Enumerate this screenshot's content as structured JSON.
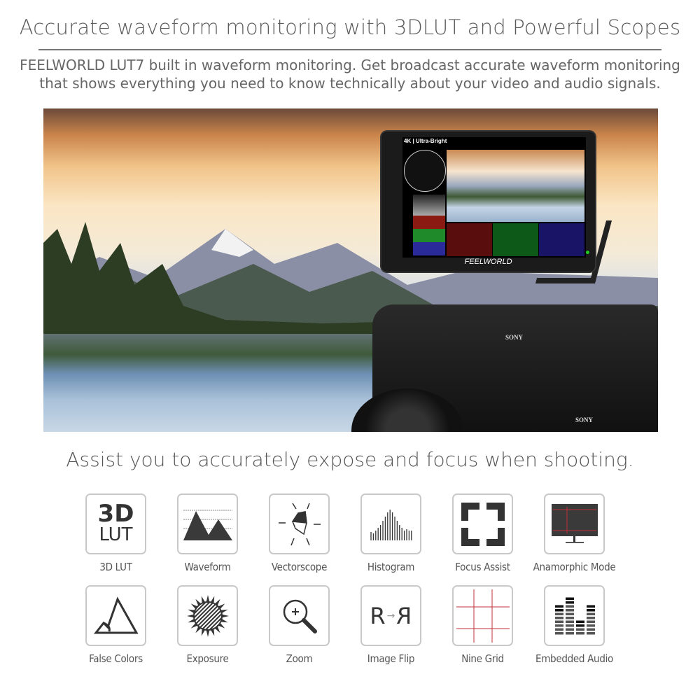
{
  "header": {
    "title": "Accurate waveform monitoring with 3DLUT and Powerful Scopes",
    "subtitle_line1": "FEELWORLD LUT7 built in waveform monitoring. Get broadcast accurate waveform monitoring",
    "subtitle_line2": "that shows everything you need to know technically about your video and audio signals."
  },
  "photo": {
    "screen_label": "4K | Ultra-Bright",
    "monitor_brand": "FEELWORLD",
    "camera_brand": "SONY"
  },
  "features_heading": "Assist you to accurately expose and focus when shooting.",
  "features": [
    {
      "label": "3D LUT",
      "icon": "3d-lut-icon",
      "icon_text_1": "3D",
      "icon_text_2": "LUT"
    },
    {
      "label": "Waveform",
      "icon": "waveform-icon"
    },
    {
      "label": "Vectorscope",
      "icon": "vectorscope-icon"
    },
    {
      "label": "Histogram",
      "icon": "histogram-icon"
    },
    {
      "label": "Focus Assist",
      "icon": "focus-assist-icon"
    },
    {
      "label": "Anamorphic Mode",
      "icon": "anamorphic-icon"
    },
    {
      "label": "False Colors",
      "icon": "false-colors-icon"
    },
    {
      "label": "Exposure",
      "icon": "exposure-icon"
    },
    {
      "label": "Zoom",
      "icon": "zoom-icon"
    },
    {
      "label": "Image Flip",
      "icon": "image-flip-icon",
      "icon_text_1": "R",
      "icon_text_2": "R"
    },
    {
      "label": "Nine Grid",
      "icon": "nine-grid-icon"
    },
    {
      "label": "Embedded Audio",
      "icon": "embedded-audio-icon"
    }
  ],
  "colors": {
    "text": "#555555",
    "grid_red": "#c0303a",
    "icon_dark": "#333333"
  }
}
